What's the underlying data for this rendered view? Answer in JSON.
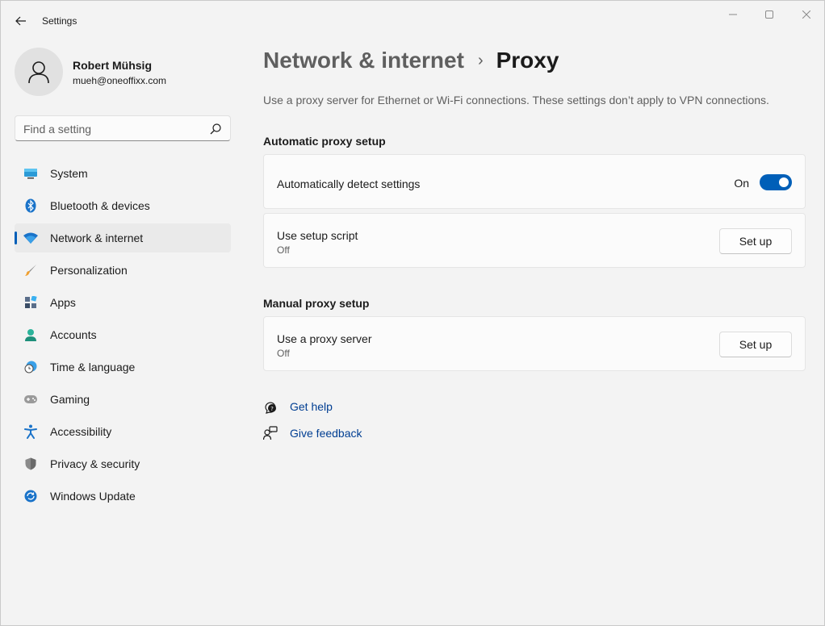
{
  "window": {
    "app_title": "Settings",
    "back_icon": "back-arrow-icon",
    "controls": [
      "minimize-icon",
      "maximize-icon",
      "close-icon"
    ]
  },
  "profile": {
    "name": "Robert Mühsig",
    "email": "mueh@oneoffixx.com"
  },
  "search": {
    "placeholder": "Find a setting"
  },
  "sidebar": {
    "items": [
      {
        "label": "System",
        "icon": "system-icon"
      },
      {
        "label": "Bluetooth & devices",
        "icon": "bluetooth-icon"
      },
      {
        "label": "Network & internet",
        "icon": "wifi-icon",
        "active": true
      },
      {
        "label": "Personalization",
        "icon": "brush-icon"
      },
      {
        "label": "Apps",
        "icon": "apps-icon"
      },
      {
        "label": "Accounts",
        "icon": "accounts-icon"
      },
      {
        "label": "Time & language",
        "icon": "clock-globe-icon"
      },
      {
        "label": "Gaming",
        "icon": "gamepad-icon"
      },
      {
        "label": "Accessibility",
        "icon": "accessibility-icon"
      },
      {
        "label": "Privacy & security",
        "icon": "shield-icon"
      },
      {
        "label": "Windows Update",
        "icon": "update-icon"
      }
    ]
  },
  "main": {
    "breadcrumb_parent": "Network & internet",
    "breadcrumb_separator": "›",
    "title": "Proxy",
    "description": "Use a proxy server for Ethernet or Wi-Fi connections. These settings don’t apply to VPN connections.",
    "auto_section": {
      "title": "Automatic proxy setup",
      "detect": {
        "label": "Automatically detect settings",
        "state": "On",
        "enabled": true
      },
      "script": {
        "label": "Use setup script",
        "status": "Off",
        "button": "Set up"
      }
    },
    "manual_section": {
      "title": "Manual proxy setup",
      "proxy": {
        "label": "Use a proxy server",
        "status": "Off",
        "button": "Set up"
      }
    },
    "links": [
      {
        "label": "Get help",
        "icon": "help-icon"
      },
      {
        "label": "Give feedback",
        "icon": "feedback-icon"
      }
    ]
  },
  "colors": {
    "accent": "#005fb8",
    "link": "#003e92",
    "background": "#f3f3f3",
    "card": "#fbfbfb"
  }
}
